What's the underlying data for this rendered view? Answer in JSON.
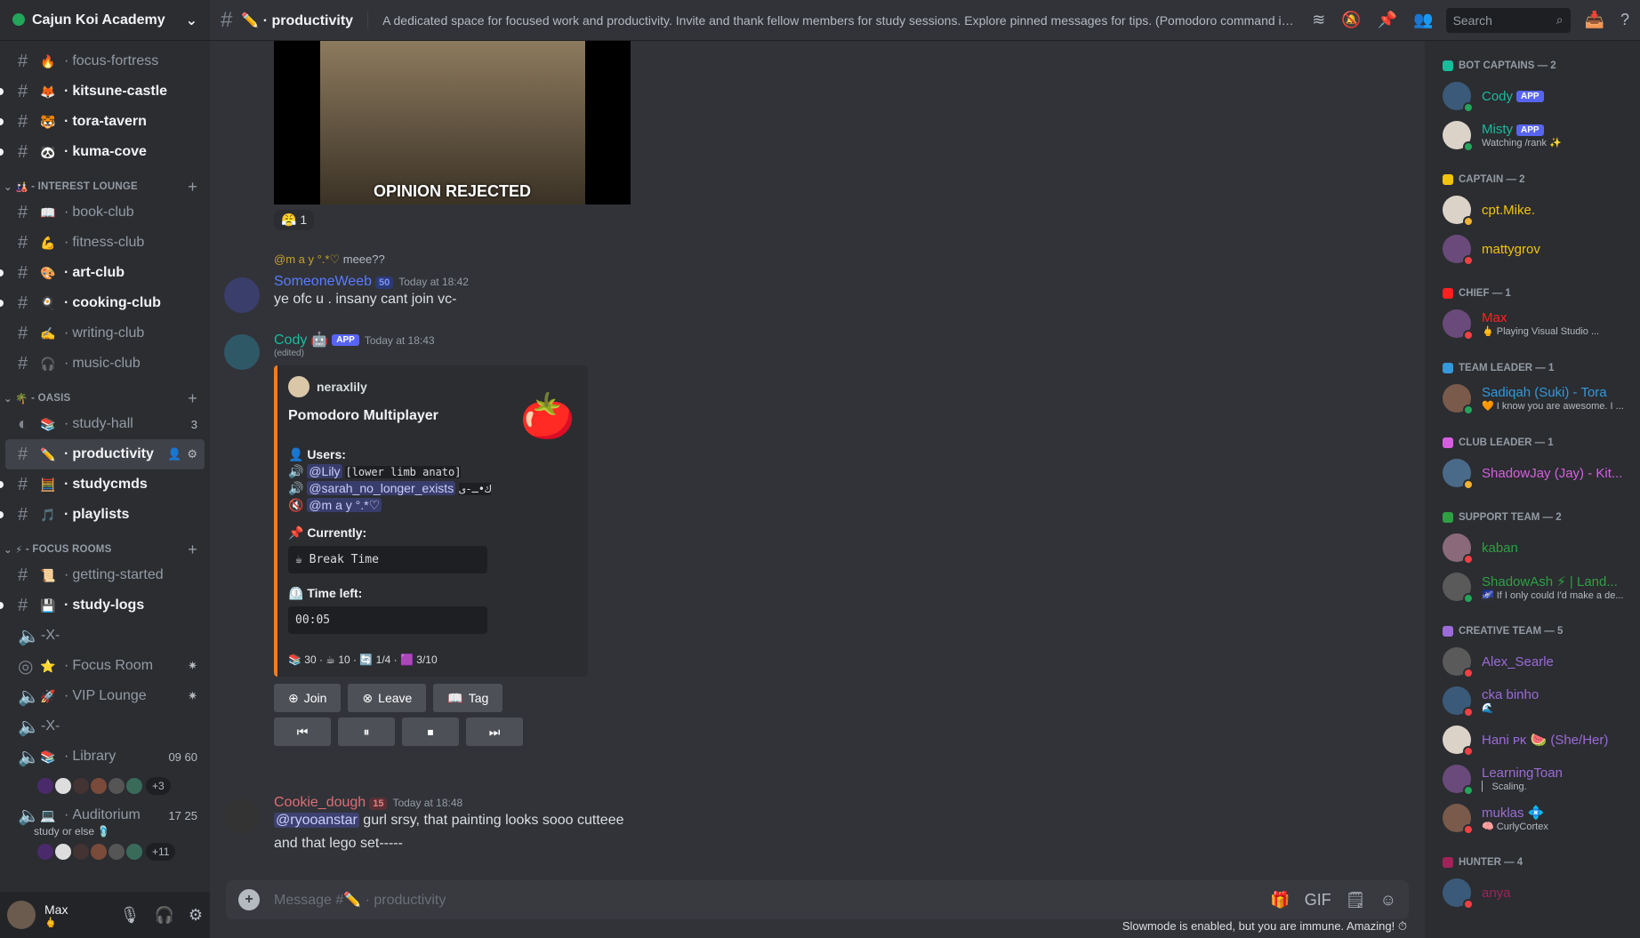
{
  "server": {
    "name": "Cajun Koi Academy"
  },
  "channels": [
    {
      "type": "text",
      "emoji": "🔥",
      "name": "focus-fortress",
      "state": "read"
    },
    {
      "type": "text",
      "emoji": "🦊",
      "name": "kitsune-castle",
      "state": "unread"
    },
    {
      "type": "text",
      "emoji": "🐯",
      "name": "tora-tavern",
      "state": "unread"
    },
    {
      "type": "text",
      "emoji": "🐼",
      "name": "kuma-cove",
      "state": "unread"
    },
    {
      "type": "category",
      "emoji": "🎎",
      "name": "INTEREST LOUNGE"
    },
    {
      "type": "locked",
      "emoji": "📖",
      "name": "book-club",
      "state": "read"
    },
    {
      "type": "locked",
      "emoji": "💪",
      "name": "fitness-club",
      "state": "read"
    },
    {
      "type": "locked",
      "emoji": "🎨",
      "name": "art-club",
      "state": "unread"
    },
    {
      "type": "locked",
      "emoji": "🍳",
      "name": "cooking-club",
      "state": "unread"
    },
    {
      "type": "locked",
      "emoji": "✍️",
      "name": "writing-club",
      "state": "read"
    },
    {
      "type": "locked",
      "emoji": "🎧",
      "name": "music-club",
      "state": "read"
    },
    {
      "type": "category",
      "emoji": "🌴",
      "name": "OASIS"
    },
    {
      "type": "forum",
      "emoji": "📚",
      "name": "study-hall",
      "state": "read",
      "count": "3"
    },
    {
      "type": "text",
      "emoji": "✏️",
      "name": "productivity",
      "state": "active"
    },
    {
      "type": "text",
      "emoji": "🧮",
      "name": "studycmds",
      "state": "unread"
    },
    {
      "type": "text",
      "emoji": "🎵",
      "name": "playlists",
      "state": "unread"
    },
    {
      "type": "category",
      "emoji": "⚡",
      "name": "FOCUS ROOMS"
    },
    {
      "type": "text",
      "emoji": "📜",
      "name": "getting-started",
      "state": "read"
    },
    {
      "type": "text",
      "emoji": "💾",
      "name": "study-logs",
      "state": "unread"
    },
    {
      "type": "voice",
      "emoji": "",
      "name": "-X-",
      "state": "read"
    },
    {
      "type": "stage",
      "emoji": "⭐",
      "name": "Focus Room",
      "state": "read",
      "count": "✷"
    },
    {
      "type": "voice",
      "emoji": "🚀",
      "name": "VIP Lounge",
      "state": "read",
      "count": "✷"
    },
    {
      "type": "voice",
      "emoji": "",
      "name": "-X-",
      "state": "read"
    },
    {
      "type": "voice",
      "emoji": "📚",
      "name": "Library",
      "state": "read",
      "count": "09  60",
      "more": "+3"
    },
    {
      "type": "voice",
      "emoji": "💻",
      "name": "Auditorium",
      "state": "read",
      "count": "17  25",
      "sub": "study or else 🩴",
      "more": "+11"
    }
  ],
  "user": {
    "name": "Max",
    "status": "🖕"
  },
  "header": {
    "channel": "productivity",
    "channel_emoji": "✏️",
    "topic": "A dedicated space for focused work and productivity. Invite and thank fellow members for study sessions. Explore pinned messages for tips. (Pomodoro command is...",
    "search_placeholder": "Search"
  },
  "video": {
    "caption": "OPINION REJECTED",
    "reaction_emoji": "😤",
    "reaction_count": "1"
  },
  "messages": {
    "reply": {
      "author": "@m a y °.*♡",
      "text": "meee??"
    },
    "m1": {
      "author": "SomeoneWeeb",
      "level": "50",
      "time": "Today at 18:42",
      "text": "ye ofc u . insany cant join vc-",
      "color": "#5b7bff"
    },
    "m2": {
      "author": "Cody",
      "app": "APP",
      "time": "Today at 18:43",
      "edited": "(edited)",
      "color": "#1abc9c"
    },
    "m3": {
      "author": "Cookie_dough",
      "level": "15",
      "time": "Today at 18:48",
      "mention": "@ryooanstar",
      "text": " gurl srsy, that painting looks sooo cutteee",
      "text2": "and that lego set-----",
      "color": "#e06c75"
    }
  },
  "embed": {
    "author": "neraxlily",
    "title": "Pomodoro Multiplayer",
    "users_label": "👤 Users:",
    "users": [
      {
        "icon": "🔊",
        "name": "@Lily",
        "extra": "[lower limb anato]"
      },
      {
        "icon": "🔊",
        "name": "@sarah_no_longer_exists",
        "extra": "ﻙ•ـ-ﻯ"
      },
      {
        "icon": "🔇",
        "name": "@m a y °.*♡",
        "extra": ""
      }
    ],
    "currently_label": "📌 Currently:",
    "currently": "☕ Break Time",
    "time_label": "⏲️ Time left:",
    "time_left": "00:05",
    "footer": "📚 30 · ☕ 10 · 🔄 1/4 · 🟪 3/10",
    "buttons": [
      "Join",
      "Leave",
      "Tag"
    ],
    "controls": [
      "⏮",
      "⏸",
      "⏹",
      "⏭"
    ]
  },
  "input": {
    "placeholder": "Message #✏️ · productivity"
  },
  "slowmode": "Slowmode is enabled, but you are immune. Amazing! ⏱",
  "members": [
    {
      "role": "BOT CAPTAINS — 2",
      "color": "#1abc9c",
      "people": [
        {
          "name": "Cody",
          "app": "APP",
          "status": "online"
        },
        {
          "name": "Misty",
          "app": "APP",
          "sub": "Watching /rank ✨",
          "status": "online"
        }
      ]
    },
    {
      "role": "CAPTAIN — 2",
      "color": "#f1c40f",
      "people": [
        {
          "name": "cpt.Mike.",
          "status": "idle"
        },
        {
          "name": "mattygrov",
          "status": "dnd"
        }
      ]
    },
    {
      "role": "CHIEF — 1",
      "color": "#ff2020",
      "people": [
        {
          "name": "Max",
          "sub": "🖕 Playing Visual Studio ...",
          "status": "dnd"
        }
      ]
    },
    {
      "role": "TEAM LEADER — 1",
      "color": "#3498db",
      "people": [
        {
          "name": "Sadiqah (Suki) - Tora",
          "sub": "🧡 I know you are awesome. I ...",
          "status": "mobile"
        }
      ]
    },
    {
      "role": "CLUB LEADER — 1",
      "color": "#d65fe0",
      "people": [
        {
          "name": "ShadowJay (Jay) - Kit...",
          "status": "idle"
        }
      ]
    },
    {
      "role": "SUPPORT TEAM — 2",
      "color": "#2ea043",
      "people": [
        {
          "name": "kaban",
          "status": "dnd"
        },
        {
          "name": "ShadowAsh ⚡ | Land...",
          "sub": "🌌 If I only could I'd make a de...",
          "status": "online"
        }
      ]
    },
    {
      "role": "CREATIVE TEAM — 5",
      "color": "#9b6bd8",
      "people": [
        {
          "name": "Alex_Searle",
          "status": "dnd"
        },
        {
          "name": "cka binho",
          "sub": "🌊",
          "status": "dnd"
        },
        {
          "name": "Hani ᴘᴋ 🍉 (She/Her)",
          "status": "dnd"
        },
        {
          "name": "LearningToan",
          "sub": "▏ Scaling.",
          "status": "mobile"
        },
        {
          "name": "muklas 💠",
          "sub": "🧠 CurlyCortex",
          "status": "dnd"
        }
      ]
    },
    {
      "role": "HUNTER — 4",
      "color": "#a0235a",
      "people": [
        {
          "name": "anya",
          "status": "dnd"
        }
      ]
    }
  ]
}
